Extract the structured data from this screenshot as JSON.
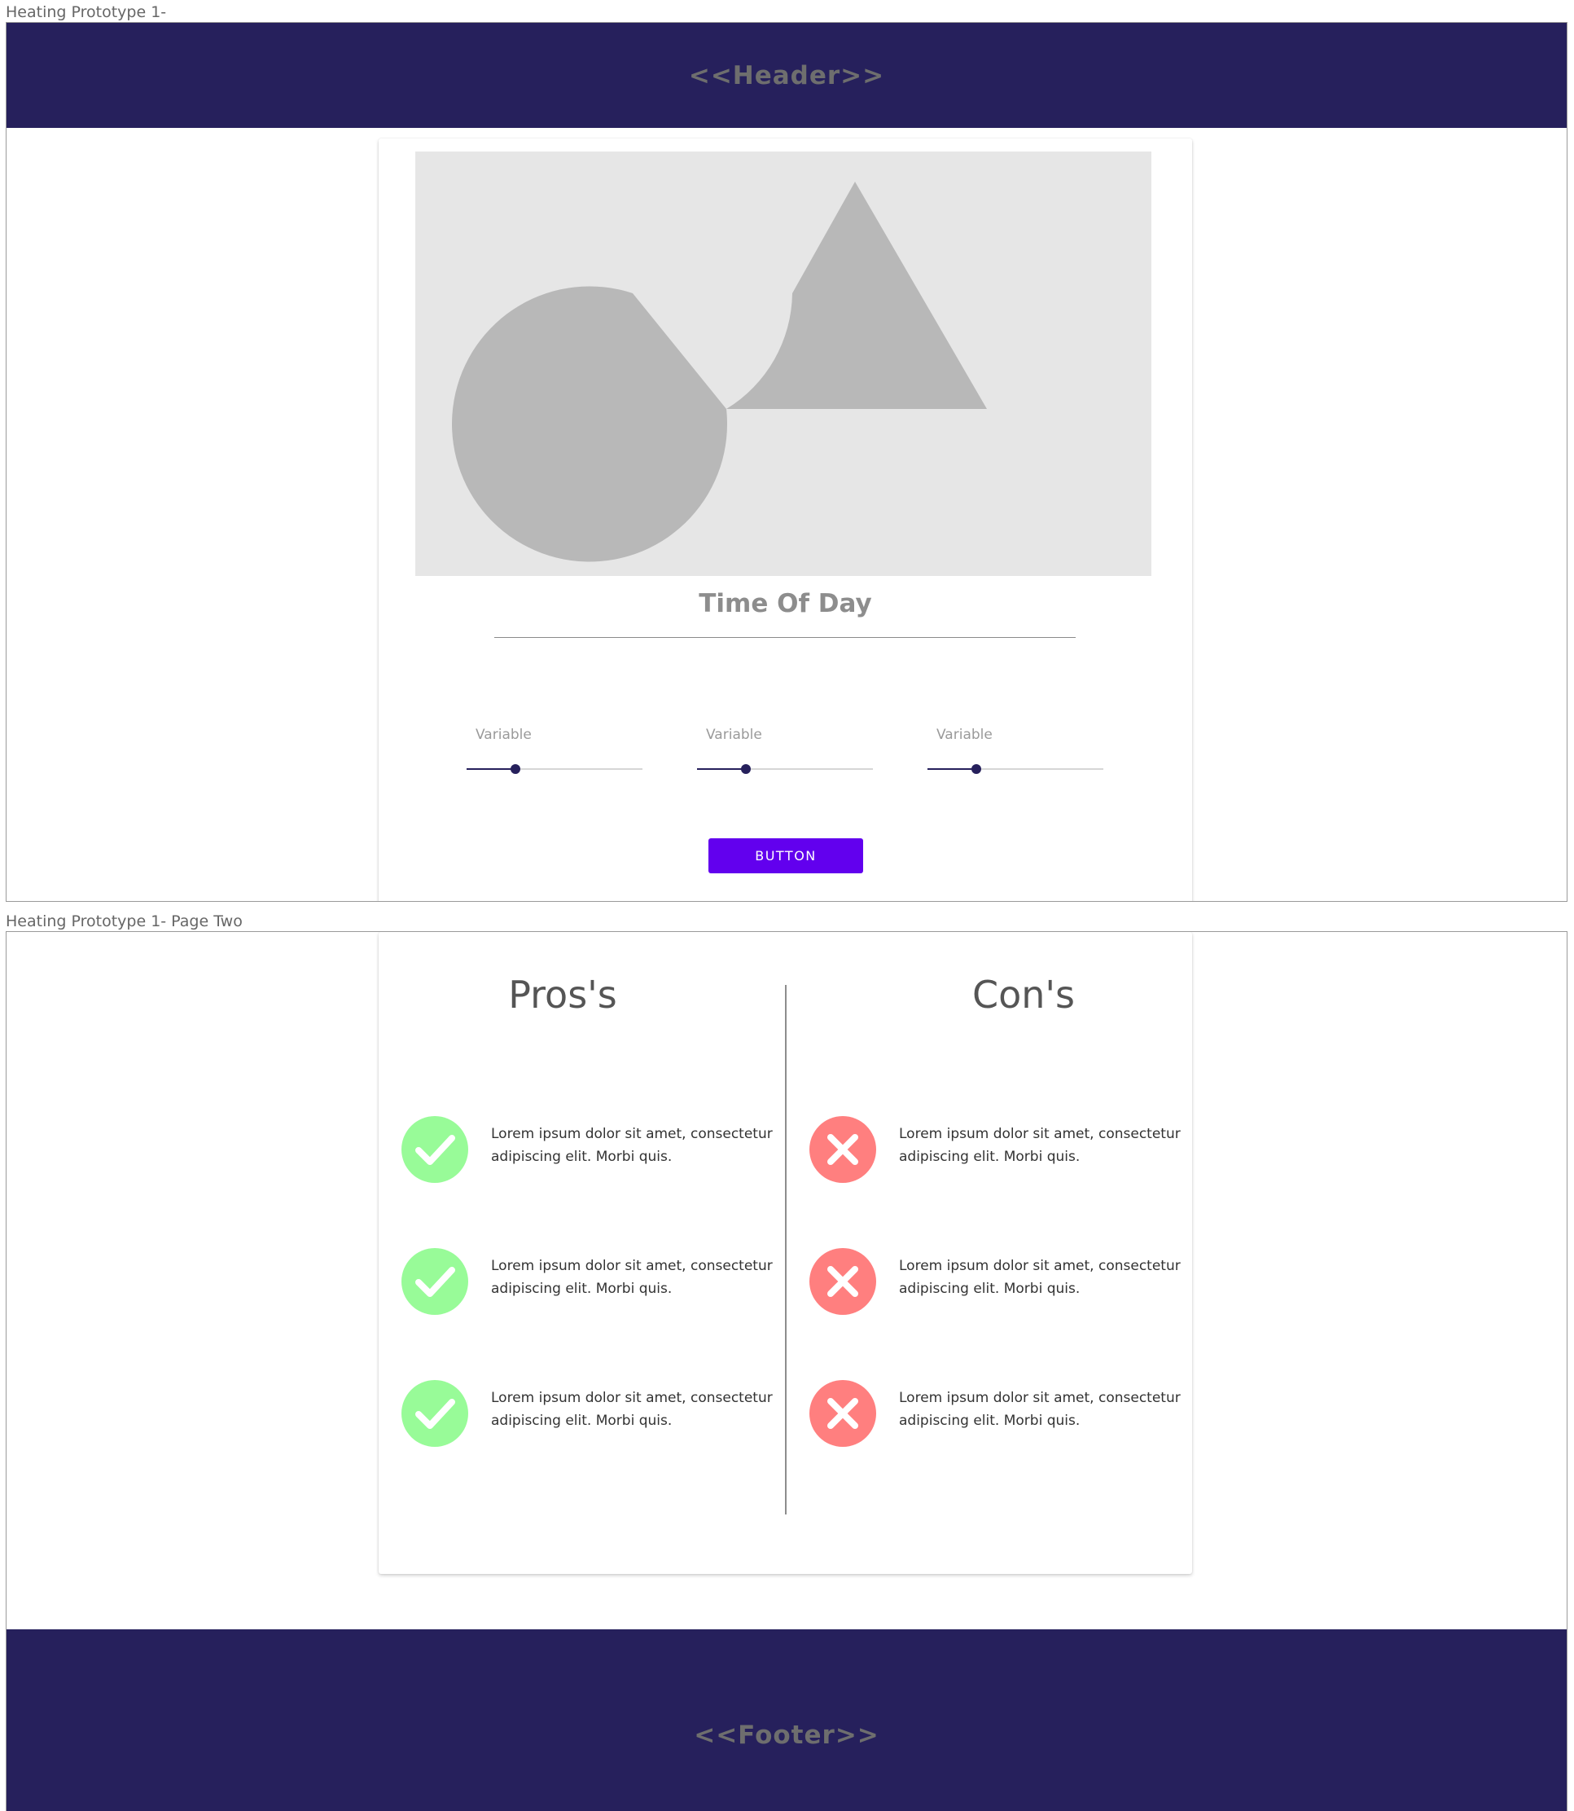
{
  "frame1": {
    "label": "Heating Prototype 1-",
    "header_text": "<<Header>>",
    "image_icon": "image-placeholder-icon",
    "title": "Time Of Day",
    "sliders": [
      {
        "label": "Variable",
        "value": 0.28
      },
      {
        "label": "Variable",
        "value": 0.28
      },
      {
        "label": "Variable",
        "value": 0.28
      }
    ],
    "button_label": "BUTTON"
  },
  "frame2": {
    "label": "Heating Prototype 1- Page Two",
    "pros_heading": "Pros's",
    "cons_heading": "Con's",
    "pros": [
      {
        "text": "Lorem ipsum dolor sit amet, consectetur adipiscing elit. Morbi quis.",
        "icon": "check-circle-icon"
      },
      {
        "text": "Lorem ipsum dolor sit amet, consectetur adipiscing elit. Morbi quis.",
        "icon": "check-circle-icon"
      },
      {
        "text": "Lorem ipsum dolor sit amet, consectetur adipiscing elit. Morbi quis.",
        "icon": "check-circle-icon"
      }
    ],
    "cons": [
      {
        "text": "Lorem ipsum dolor sit amet, consectetur adipiscing elit. Morbi quis.",
        "icon": "x-circle-icon"
      },
      {
        "text": "Lorem ipsum dolor sit amet, consectetur adipiscing elit. Morbi quis.",
        "icon": "x-circle-icon"
      },
      {
        "text": "Lorem ipsum dolor sit amet, consectetur adipiscing elit. Morbi quis.",
        "icon": "x-circle-icon"
      }
    ],
    "footer_text": "<<Footer>>"
  },
  "colors": {
    "bar": "#26205c",
    "accent": "#6200ee",
    "pro": "#98fb98",
    "con": "#ff7f7f",
    "placeholder": "#e6e6e6",
    "placeholder_shape": "#b8b8b8"
  }
}
